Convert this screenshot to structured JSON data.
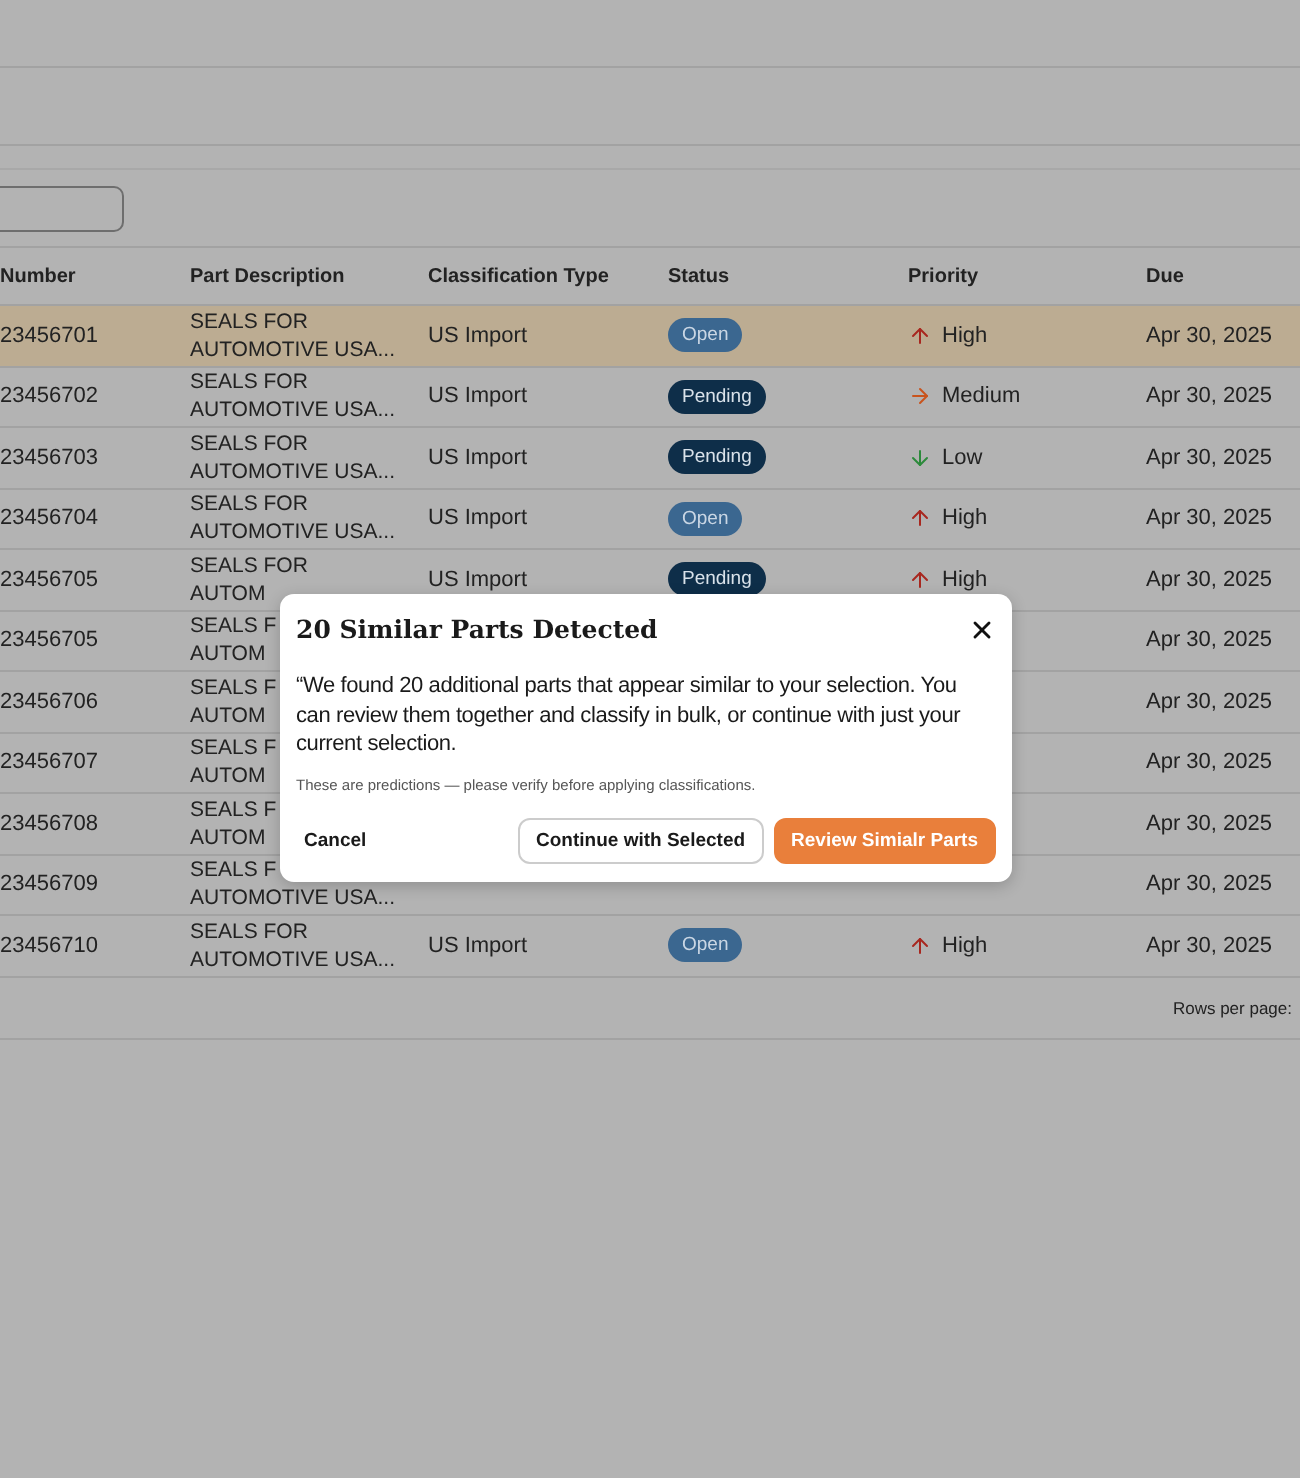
{
  "table": {
    "columns": [
      "Number",
      "Part Description",
      "Classification Type",
      "Status",
      "Priority",
      "Due"
    ],
    "rows": [
      {
        "number": "23456701",
        "description": [
          "SEALS FOR",
          "AUTOMOTIVE USA..."
        ],
        "classification": "US Import",
        "status": {
          "kind": "open",
          "label": "Open"
        },
        "priority": {
          "kind": "high",
          "label": "High"
        },
        "due": "Apr 30, 2025",
        "selected": true
      },
      {
        "number": "23456702",
        "description": [
          "SEALS FOR",
          "AUTOMOTIVE USA..."
        ],
        "classification": "US Import",
        "status": {
          "kind": "pending",
          "label": "Pending"
        },
        "priority": {
          "kind": "medium",
          "label": "Medium"
        },
        "due": "Apr 30, 2025",
        "selected": false
      },
      {
        "number": "23456703",
        "description": [
          "SEALS FOR",
          "AUTOMOTIVE USA..."
        ],
        "classification": "US Import",
        "status": {
          "kind": "pending",
          "label": "Pending"
        },
        "priority": {
          "kind": "low",
          "label": "Low"
        },
        "due": "Apr 30, 2025",
        "selected": false
      },
      {
        "number": "23456704",
        "description": [
          "SEALS FOR",
          "AUTOMOTIVE USA..."
        ],
        "classification": "US Import",
        "status": {
          "kind": "open",
          "label": "Open"
        },
        "priority": {
          "kind": "high",
          "label": "High"
        },
        "due": "Apr 30, 2025",
        "selected": false
      },
      {
        "number": "23456705",
        "description": [
          "SEALS FOR",
          "AUTOM"
        ],
        "classification": "US Import",
        "status": {
          "kind": "pending",
          "label": "Pending"
        },
        "priority": {
          "kind": "high",
          "label": "High"
        },
        "due": "Apr 30, 2025",
        "selected": false
      },
      {
        "number": "23456705",
        "description": [
          "SEALS F",
          "AUTOM"
        ],
        "due": "Apr 30, 2025",
        "selected": false
      },
      {
        "number": "23456706",
        "description": [
          "SEALS F",
          "AUTOM"
        ],
        "due": "Apr 30, 2025",
        "selected": false
      },
      {
        "number": "23456707",
        "description": [
          "SEALS F",
          "AUTOM"
        ],
        "due": "Apr 30, 2025",
        "selected": false
      },
      {
        "number": "23456708",
        "description": [
          "SEALS F",
          "AUTOM"
        ],
        "due": "Apr 30, 2025",
        "selected": false
      },
      {
        "number": "23456709",
        "description": [
          "SEALS F",
          "AUTOMOTIVE USA..."
        ],
        "due": "Apr 30, 2025",
        "selected": false
      },
      {
        "number": "23456710",
        "description": [
          "SEALS FOR",
          "AUTOMOTIVE USA..."
        ],
        "classification": "US Import",
        "status": {
          "kind": "open",
          "label": "Open"
        },
        "priority": {
          "kind": "high",
          "label": "High"
        },
        "due": "Apr 30, 2025",
        "selected": false
      }
    ]
  },
  "pagination": {
    "rows_per_page_label": "Rows per page:"
  },
  "dialog": {
    "title": "20 Similar Parts Detected",
    "message": "“We found 20 additional parts that appear similar to your selection. You can review them together and classify in bulk, or continue with just your current selection.",
    "note": "These are predictions — please verify before applying classifications.",
    "buttons": [
      {
        "kind": "text",
        "label": "Cancel"
      },
      {
        "kind": "outline",
        "label": "Continue with Selected"
      },
      {
        "kind": "primary",
        "label": "Review Simialr Parts"
      }
    ]
  }
}
